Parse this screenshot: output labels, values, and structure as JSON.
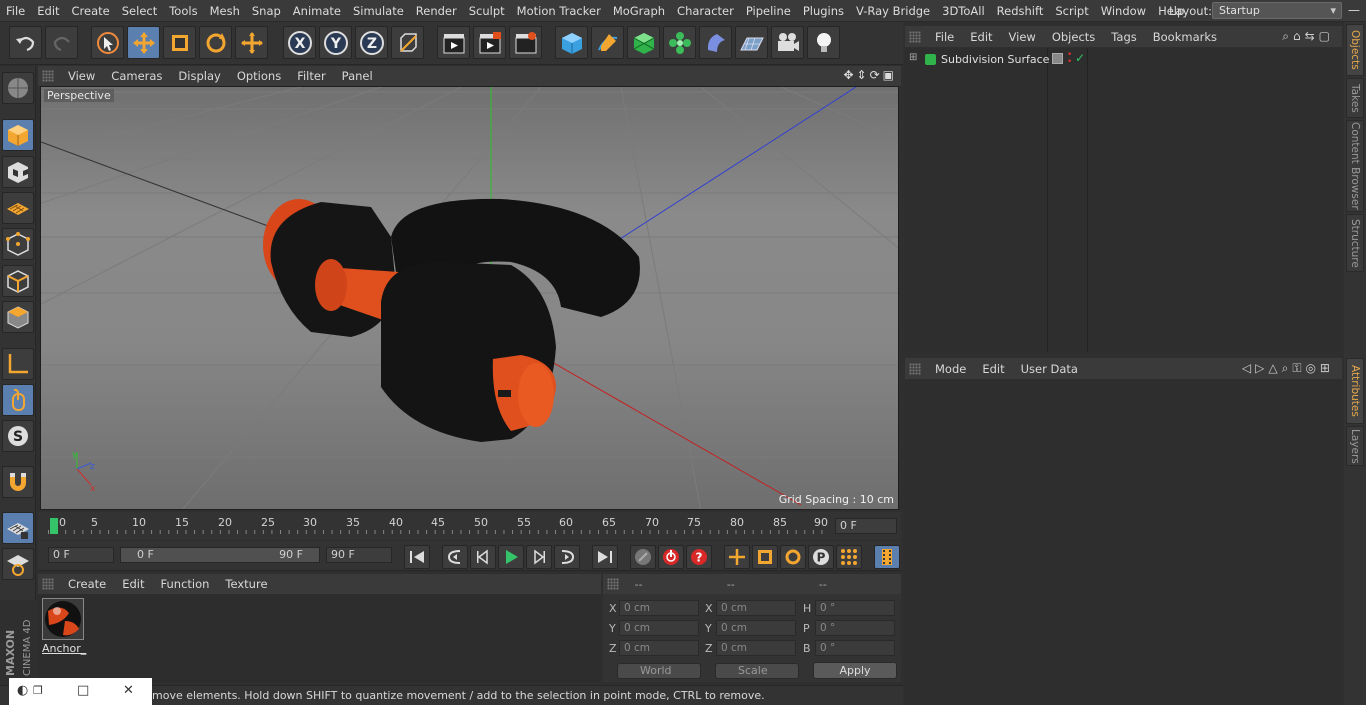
{
  "menubar": {
    "items": [
      "File",
      "Edit",
      "Create",
      "Select",
      "Tools",
      "Mesh",
      "Snap",
      "Animate",
      "Simulate",
      "Render",
      "Sculpt",
      "Motion Tracker",
      "MoGraph",
      "Character",
      "Pipeline",
      "Plugins",
      "V-Ray Bridge",
      "3DToAll",
      "Redshift",
      "Script",
      "Window",
      "Help"
    ],
    "layout_label": "Layout:",
    "layout_value": "Startup"
  },
  "viewport": {
    "menu": [
      "View",
      "Cameras",
      "Display",
      "Options",
      "Filter",
      "Panel"
    ],
    "label": "Perspective",
    "grid_spacing": "Grid Spacing : 10 cm"
  },
  "timeline": {
    "ticks": [
      "0",
      "5",
      "10",
      "15",
      "20",
      "25",
      "30",
      "35",
      "40",
      "45",
      "50",
      "55",
      "60",
      "65",
      "70",
      "75",
      "80",
      "85",
      "90"
    ],
    "current_frame": "0 F"
  },
  "transport": {
    "start": "0 F",
    "range_start": "0 F",
    "range_end": "90 F",
    "end": "90 F"
  },
  "material": {
    "menu": [
      "Create",
      "Edit",
      "Function",
      "Texture"
    ],
    "name": "Anchor_"
  },
  "coords": {
    "headers": [
      "--",
      "--",
      "--"
    ],
    "rows": [
      {
        "l1": "X",
        "v1": "0 cm",
        "l2": "X",
        "v2": "0 cm",
        "l3": "H",
        "v3": "0 °"
      },
      {
        "l1": "Y",
        "v1": "0 cm",
        "l2": "Y",
        "v2": "0 cm",
        "l3": "P",
        "v3": "0 °"
      },
      {
        "l1": "Z",
        "v1": "0 cm",
        "l2": "Z",
        "v2": "0 cm",
        "l3": "B",
        "v3": "0 °"
      }
    ],
    "world": "World",
    "scale": "Scale",
    "apply": "Apply"
  },
  "objects": {
    "menu": [
      "File",
      "Edit",
      "View",
      "Objects",
      "Tags",
      "Bookmarks"
    ],
    "item": "Subdivision Surface"
  },
  "attributes": {
    "menu": [
      "Mode",
      "Edit",
      "User Data"
    ]
  },
  "side_tabs": [
    "Objects",
    "Takes",
    "Content Browser",
    "Structure",
    "Attributes",
    "Layers"
  ],
  "status": "move elements. Hold down SHIFT to quantize movement / add to the selection in point mode, CTRL to remove.",
  "brand": [
    "MAXON",
    "CINEMA 4D"
  ],
  "colors": {
    "accent": "#5b7fae",
    "object_orange": "#e0501e",
    "tab_active": "#e8a94a"
  }
}
